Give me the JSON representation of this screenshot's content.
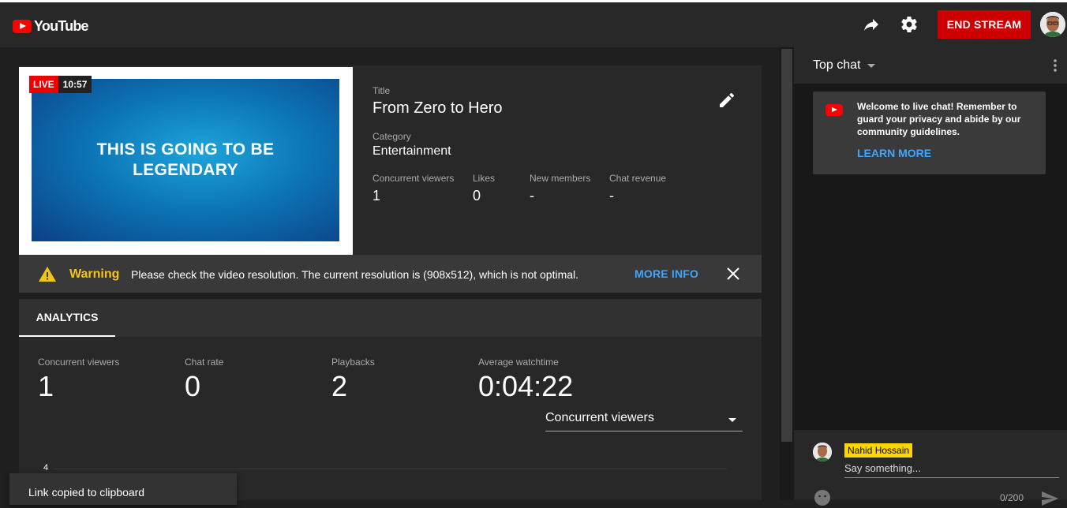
{
  "header": {
    "logo_text": "YouTube",
    "end_stream_label": "END STREAM"
  },
  "stream": {
    "thumbnail_text": "THIS IS GOING TO BE LEGENDARY",
    "live_label": "LIVE",
    "live_time": "10:57",
    "title_label": "Title",
    "title": "From Zero to Hero",
    "category_label": "Category",
    "category": "Entertainment",
    "stats": [
      {
        "label": "Concurrent viewers",
        "value": "1"
      },
      {
        "label": "Likes",
        "value": "0"
      },
      {
        "label": "New members",
        "value": "-"
      },
      {
        "label": "Chat revenue",
        "value": "-"
      }
    ]
  },
  "warning": {
    "title": "Warning",
    "message": "Please check the video resolution. The current resolution is (908x512), which is not optimal.",
    "more_info": "MORE INFO"
  },
  "analytics": {
    "tab_label": "ANALYTICS",
    "metrics": [
      {
        "label": "Concurrent viewers",
        "value": "1"
      },
      {
        "label": "Chat rate",
        "value": "0"
      },
      {
        "label": "Playbacks",
        "value": "2"
      },
      {
        "label": "Average watchtime",
        "value": "0:04:22"
      }
    ],
    "selector_value": "Concurrent viewers",
    "axis_tick": "4"
  },
  "toast": {
    "message": "Link copied to clipboard"
  },
  "chat": {
    "title": "Top chat",
    "welcome_message": "Welcome to live chat! Remember to guard your privacy and abide by our community guidelines.",
    "learn_more": "LEARN MORE",
    "user_name": "Nahid Hossain",
    "input_placeholder": "Say something...",
    "char_count": "0/200"
  },
  "colors": {
    "accent_red": "#cc0000",
    "link_blue": "#3ea6ff",
    "warning_yellow": "#f3c31b",
    "name_badge_yellow": "#ffd600"
  },
  "icons": [
    "share-icon",
    "gear-icon",
    "edit-icon",
    "warning-icon",
    "close-icon",
    "dropdown-icon",
    "kebab-icon",
    "emoji-icon",
    "send-icon"
  ]
}
